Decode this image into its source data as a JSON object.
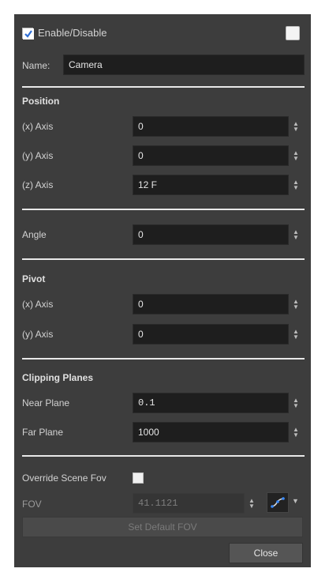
{
  "header": {
    "enable_label": "Enable/Disable",
    "enabled": true
  },
  "name": {
    "label": "Name:",
    "value": "Camera"
  },
  "position": {
    "title": "Position",
    "x_label": "(x) Axis",
    "x_value": "0",
    "y_label": "(y) Axis",
    "y_value": "0",
    "z_label": "(z) Axis",
    "z_value": "12 F"
  },
  "angle": {
    "label": "Angle",
    "value": "0"
  },
  "pivot": {
    "title": "Pivot",
    "x_label": "(x) Axis",
    "x_value": "0",
    "y_label": "(y) Axis",
    "y_value": "0"
  },
  "clipping": {
    "title": "Clipping Planes",
    "near_label": "Near Plane",
    "near_value": "0.1",
    "far_label": "Far Plane",
    "far_value": "1000"
  },
  "fov": {
    "override_label": "Override Scene Fov",
    "override_checked": false,
    "label": "FOV",
    "value": "41.1121",
    "set_default_label": "Set Default FOV"
  },
  "footer": {
    "close_label": "Close"
  },
  "colors": {
    "panel": "#3d3d3d",
    "field": "#1e1e1e",
    "divider": "#e8e8e8",
    "check_accent": "#2f6fd6"
  }
}
